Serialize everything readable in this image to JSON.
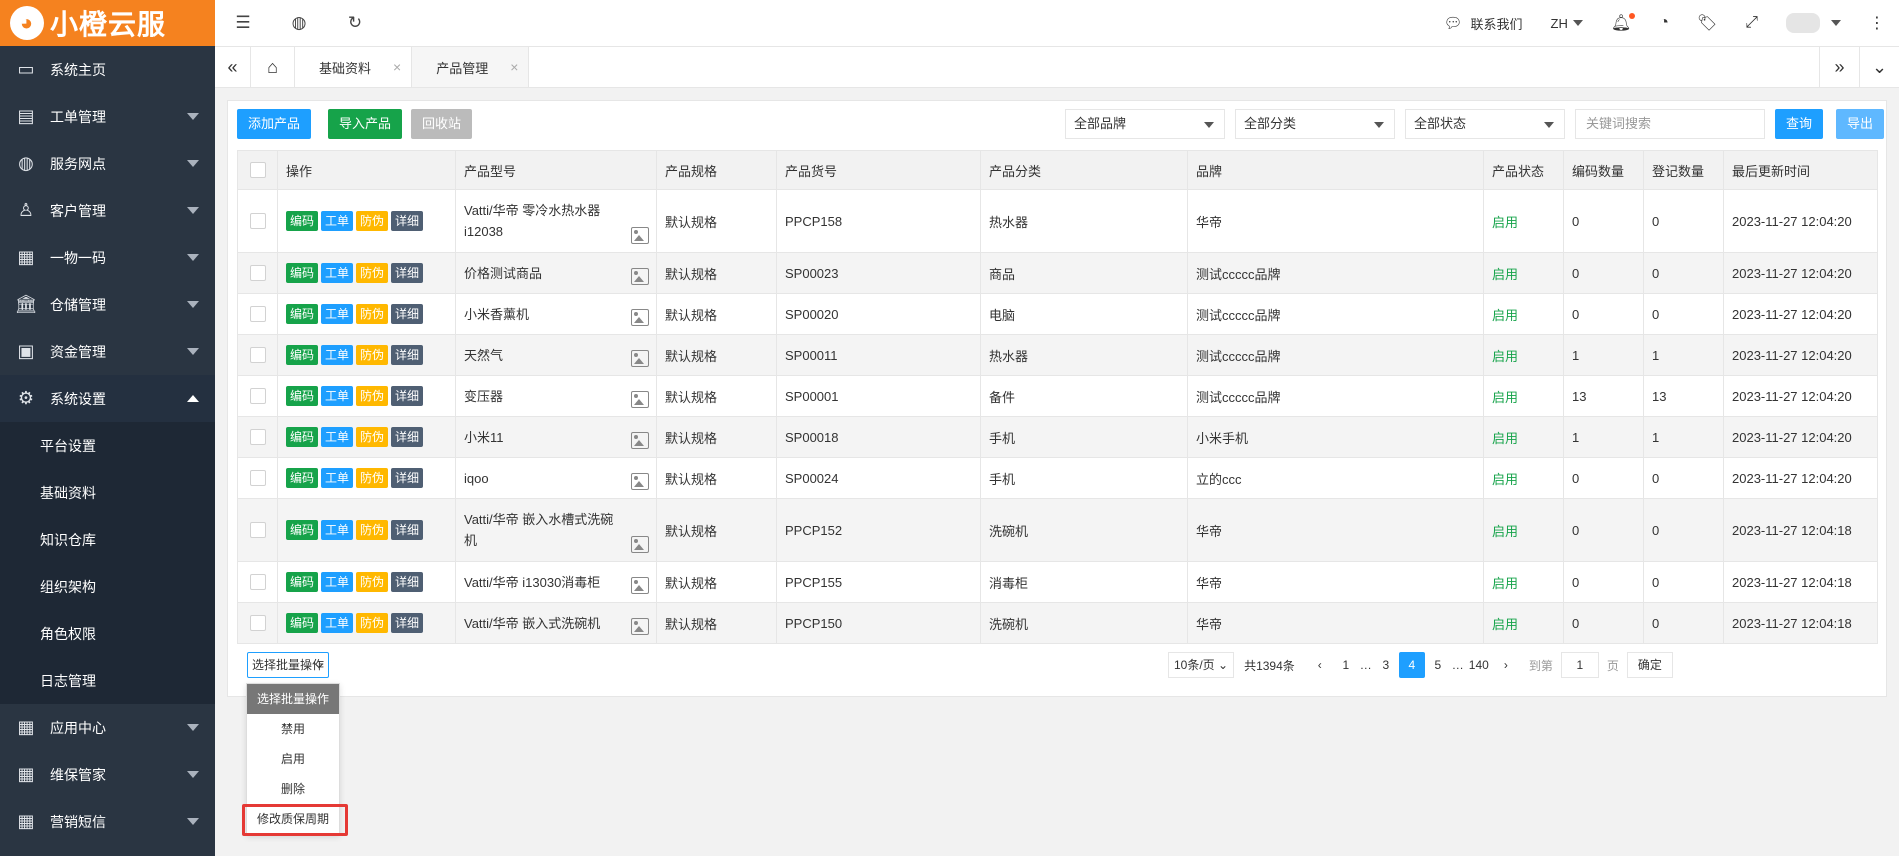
{
  "app": {
    "name": "小橙云服"
  },
  "sidebar": {
    "items": [
      {
        "label": "系统主页",
        "icon": "monitor-icon"
      },
      {
        "label": "工单管理",
        "icon": "document-icon"
      },
      {
        "label": "服务网点",
        "icon": "globe-icon"
      },
      {
        "label": "客户管理",
        "icon": "user-icon"
      },
      {
        "label": "一物一码",
        "icon": "grid-icon"
      },
      {
        "label": "仓储管理",
        "icon": "bank-icon"
      },
      {
        "label": "资金管理",
        "icon": "money-icon"
      },
      {
        "label": "系统设置",
        "icon": "gear-icon"
      }
    ],
    "sub_items": [
      "平台设置",
      "基础资料",
      "知识仓库",
      "组织架构",
      "角色权限",
      "日志管理"
    ],
    "bottom_items": [
      {
        "label": "应用中心",
        "icon": "grid-icon"
      },
      {
        "label": "维保管家",
        "icon": "grid-icon"
      },
      {
        "label": "营销短信",
        "icon": "grid-icon"
      }
    ]
  },
  "topbar": {
    "contact": "联系我们",
    "lang": "ZH"
  },
  "tabs": [
    {
      "label": "基础资料"
    },
    {
      "label": "产品管理"
    }
  ],
  "toolbar": {
    "add_label": "添加产品",
    "import_label": "导入产品",
    "recycle_label": "回收站",
    "brand_select": "全部品牌",
    "category_select": "全部分类",
    "status_select": "全部状态",
    "search_placeholder": "关键词搜索",
    "query_label": "查询",
    "export_label": "导出"
  },
  "table": {
    "headers": [
      "操作",
      "产品型号",
      "产品规格",
      "产品货号",
      "产品分类",
      "品牌",
      "产品状态",
      "编码数量",
      "登记数量",
      "最后更新时间"
    ],
    "actions": [
      "编码",
      "工单",
      "防伪",
      "详细"
    ],
    "rows": [
      {
        "model": "Vatti/华帝 零冷水热水器 i12038",
        "spec": "默认规格",
        "sku": "PPCP158",
        "category": "热水器",
        "brand": "华帝",
        "status": "启用",
        "codes": "0",
        "registered": "0",
        "updated": "2023-11-27 12:04:20"
      },
      {
        "model": "价格测试商品",
        "spec": "默认规格",
        "sku": "SP00023",
        "category": "商品",
        "brand": "测试ccccc品牌",
        "status": "启用",
        "codes": "0",
        "registered": "0",
        "updated": "2023-11-27 12:04:20"
      },
      {
        "model": "小米香薰机",
        "spec": "默认规格",
        "sku": "SP00020",
        "category": "电脑",
        "brand": "测试ccccc品牌",
        "status": "启用",
        "codes": "0",
        "registered": "0",
        "updated": "2023-11-27 12:04:20"
      },
      {
        "model": "天然气",
        "spec": "默认规格",
        "sku": "SP00011",
        "category": "热水器",
        "brand": "测试ccccc品牌",
        "status": "启用",
        "codes": "1",
        "registered": "1",
        "updated": "2023-11-27 12:04:20"
      },
      {
        "model": "变压器",
        "spec": "默认规格",
        "sku": "SP00001",
        "category": "备件",
        "brand": "测试ccccc品牌",
        "status": "启用",
        "codes": "13",
        "registered": "13",
        "updated": "2023-11-27 12:04:20"
      },
      {
        "model": "小米11",
        "spec": "默认规格",
        "sku": "SP00018",
        "category": "手机",
        "brand": "小米手机",
        "status": "启用",
        "codes": "1",
        "registered": "1",
        "updated": "2023-11-27 12:04:20"
      },
      {
        "model": "iqoo",
        "spec": "默认规格",
        "sku": "SP00024",
        "category": "手机",
        "brand": "立的ccc",
        "status": "启用",
        "codes": "0",
        "registered": "0",
        "updated": "2023-11-27 12:04:20"
      },
      {
        "model": "Vatti/华帝 嵌入水槽式洗碗机",
        "spec": "默认规格",
        "sku": "PPCP152",
        "category": "洗碗机",
        "brand": "华帝",
        "status": "启用",
        "codes": "0",
        "registered": "0",
        "updated": "2023-11-27 12:04:18"
      },
      {
        "model": "Vatti/华帝 i13030消毒柜",
        "spec": "默认规格",
        "sku": "PPCP155",
        "category": "消毒柜",
        "brand": "华帝",
        "status": "启用",
        "codes": "0",
        "registered": "0",
        "updated": "2023-11-27 12:04:18"
      },
      {
        "model": "Vatti/华帝 嵌入式洗碗机",
        "spec": "默认规格",
        "sku": "PPCP150",
        "category": "洗碗机",
        "brand": "华帝",
        "status": "启用",
        "codes": "0",
        "registered": "0",
        "updated": "2023-11-27 12:04:18"
      }
    ]
  },
  "batch": {
    "label": "选择批量操作",
    "options": [
      "选择批量操作",
      "禁用",
      "启用",
      "删除",
      "修改质保周期"
    ]
  },
  "pagination": {
    "page_size": "10条/页",
    "total": "共1394条",
    "pages": [
      "1",
      "…",
      "3",
      "4",
      "5",
      "…",
      "140"
    ],
    "current": "4",
    "goto_label": "到第",
    "goto_value": "1",
    "page_unit": "页",
    "confirm_label": "确定"
  }
}
